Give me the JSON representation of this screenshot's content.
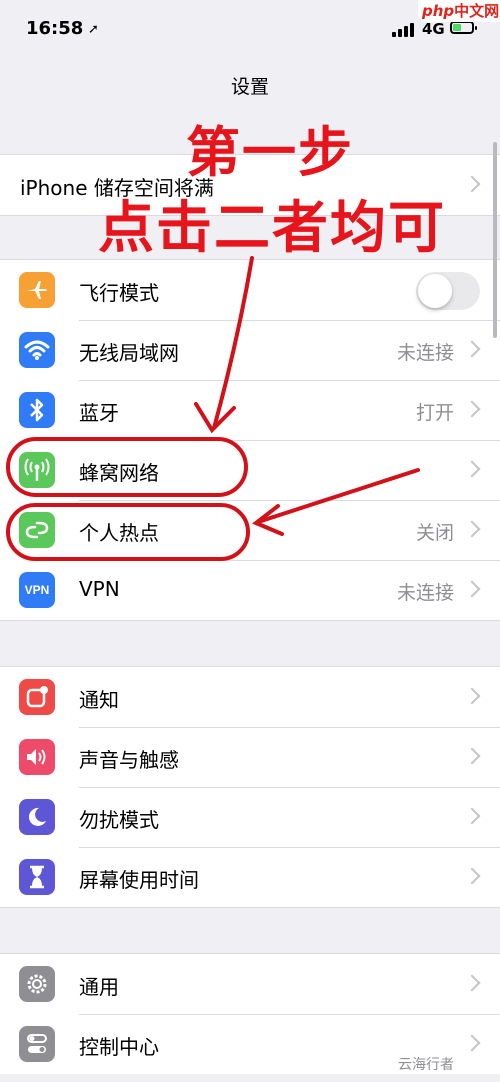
{
  "status_bar": {
    "time": "16:58",
    "network": "4G"
  },
  "watermark": {
    "top_php": "php",
    "top_cn": "中文网",
    "bottom": "云海行者"
  },
  "nav": {
    "title": "设置"
  },
  "storage": {
    "label": "iPhone 储存空间将满"
  },
  "network_group": [
    {
      "label": "飞行模式",
      "value": "",
      "icon": "airplane-icon",
      "color": "#f7a033",
      "toggle": true
    },
    {
      "label": "无线局域网",
      "value": "未连接",
      "icon": "wifi-icon",
      "color": "#2f7cf6"
    },
    {
      "label": "蓝牙",
      "value": "打开",
      "icon": "bluetooth-icon",
      "color": "#2f7cf6"
    },
    {
      "label": "蜂窝网络",
      "value": "",
      "icon": "antenna-icon",
      "color": "#5ac85a"
    },
    {
      "label": "个人热点",
      "value": "关闭",
      "icon": "hotspot-icon",
      "color": "#5ac85a"
    },
    {
      "label": "VPN",
      "value": "未连接",
      "icon": "vpn-icon",
      "color": "#2f7cf6",
      "icon_text": "VPN"
    }
  ],
  "notify_group": [
    {
      "label": "通知",
      "icon": "notification-icon",
      "color": "#ee4a47"
    },
    {
      "label": "声音与触感",
      "icon": "speaker-icon",
      "color": "#ee4a6a"
    },
    {
      "label": "勿扰模式",
      "icon": "moon-icon",
      "color": "#5d57d6"
    },
    {
      "label": "屏幕使用时间",
      "icon": "hourglass-icon",
      "color": "#5d57d6"
    }
  ],
  "general_group": [
    {
      "label": "通用",
      "icon": "gear-icon",
      "color": "#8e8e93"
    },
    {
      "label": "控制中心",
      "icon": "toggles-icon",
      "color": "#8e8e93"
    }
  ],
  "annotation": {
    "line1": "第一步",
    "line2": "点击二者均可"
  },
  "colors": {
    "annotation_red": "#e8141b"
  }
}
